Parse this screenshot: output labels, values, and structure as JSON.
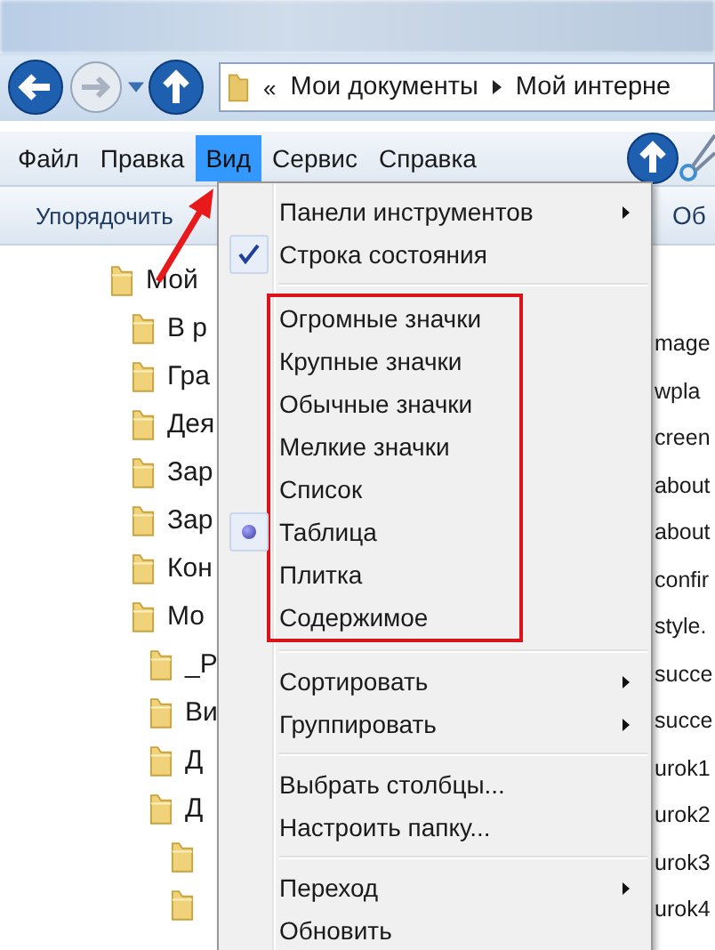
{
  "address_bar": {
    "overflow": "«",
    "path": [
      "Мои документы",
      "Мой интерне"
    ]
  },
  "menu_bar": [
    {
      "label": "Файл",
      "selected": false
    },
    {
      "label": "Правка",
      "selected": false
    },
    {
      "label": "Вид",
      "selected": true
    },
    {
      "label": "Сервис",
      "selected": false
    },
    {
      "label": "Справка",
      "selected": false
    }
  ],
  "toolbar": {
    "organize": "Упорядочить",
    "right_label": "Об"
  },
  "tree": [
    {
      "kind": "folder",
      "label": "Мой",
      "children": [
        {
          "kind": "folder",
          "label": "В р"
        },
        {
          "kind": "folder",
          "label": "Гра"
        },
        {
          "kind": "folder",
          "label": "Дея"
        },
        {
          "kind": "folder",
          "label": "Зар"
        },
        {
          "kind": "folder",
          "label": "Зар"
        },
        {
          "kind": "folder",
          "label": "Кон"
        },
        {
          "kind": "folder",
          "label": "Мо",
          "children": [
            {
              "kind": "folder",
              "label": "_Р"
            },
            {
              "kind": "folder",
              "label": "Ви"
            },
            {
              "kind": "folder",
              "label": "Д"
            },
            {
              "kind": "folder",
              "label": "Д",
              "children": [
                {
                  "kind": "folder"
                },
                {
                  "kind": "folder"
                }
              ]
            }
          ]
        }
      ]
    }
  ],
  "files": [
    "mage",
    "wpla",
    "creen",
    "about",
    "about",
    "confir",
    "style.",
    "succe",
    "succe",
    "urok1",
    "urok2",
    "urok3",
    "urok4"
  ],
  "view_menu": [
    {
      "highlighted": false,
      "items": [
        {
          "label": "Панели инструментов",
          "submenu": true,
          "checked": false
        },
        {
          "label": "Строка состояния",
          "submenu": false,
          "checked": true
        }
      ]
    },
    {
      "highlighted": true,
      "items": [
        {
          "label": "Огромные значки",
          "selected": false
        },
        {
          "label": "Крупные значки",
          "selected": false
        },
        {
          "label": "Обычные значки",
          "selected": false
        },
        {
          "label": "Мелкие значки",
          "selected": false
        },
        {
          "label": "Список",
          "selected": false
        },
        {
          "label": "Таблица",
          "selected": true
        },
        {
          "label": "Плитка",
          "selected": false
        },
        {
          "label": "Содержимое",
          "selected": false
        }
      ]
    },
    {
      "highlighted": false,
      "items": [
        {
          "label": "Сортировать",
          "submenu": true
        },
        {
          "label": "Группировать",
          "submenu": true
        }
      ]
    },
    {
      "highlighted": false,
      "items": [
        {
          "label": "Выбрать столбцы...",
          "submenu": false
        },
        {
          "label": "Настроить папку...",
          "submenu": false
        }
      ]
    },
    {
      "highlighted": false,
      "items": [
        {
          "label": "Переход",
          "submenu": true
        },
        {
          "label": "Обновить",
          "submenu": false
        }
      ]
    }
  ]
}
